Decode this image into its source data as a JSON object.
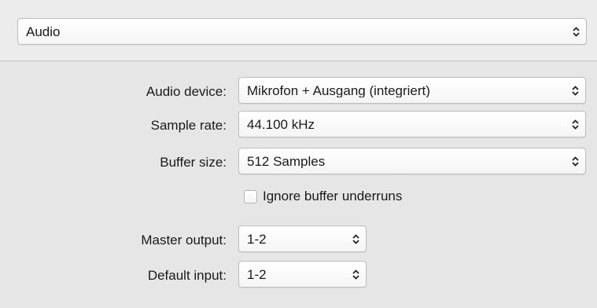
{
  "section_popup": {
    "value": "Audio"
  },
  "form": {
    "audio_device": {
      "label": "Audio device:",
      "value": "Mikrofon + Ausgang (integriert)"
    },
    "sample_rate": {
      "label": "Sample rate:",
      "value": "44.100 kHz"
    },
    "buffer_size": {
      "label": "Buffer size:",
      "value": "512 Samples"
    },
    "ignore_underruns": {
      "label": "Ignore buffer underruns",
      "checked": false
    },
    "master_output": {
      "label": "Master output:",
      "value": "1-2"
    },
    "default_input": {
      "label": "Default input:",
      "value": "1-2"
    }
  },
  "icons": {
    "popup_arrows": "up-down-chevron-icon"
  }
}
